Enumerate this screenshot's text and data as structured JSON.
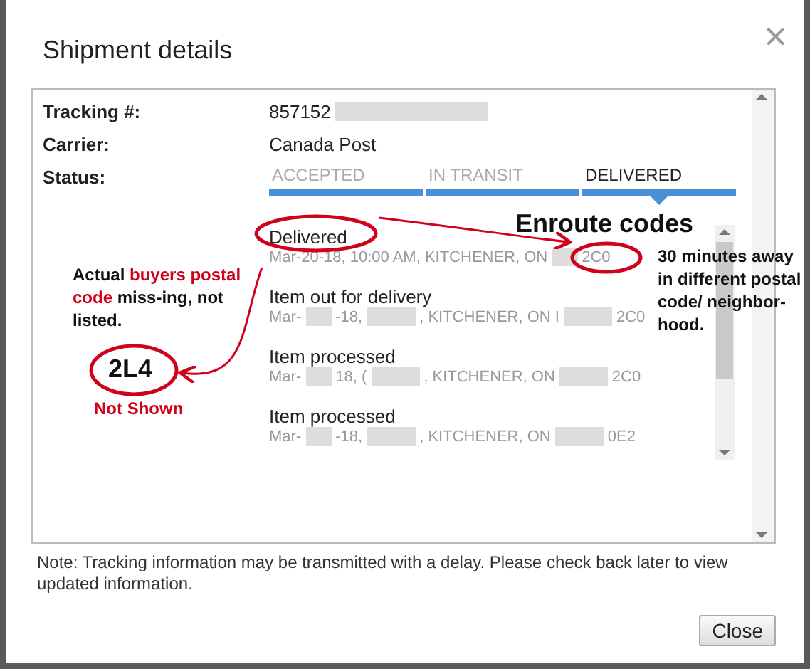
{
  "dialog": {
    "title": "Shipment details",
    "close_icon": "×"
  },
  "fields": [
    {
      "label": "Tracking #:",
      "value": "857152",
      "redacted": true
    },
    {
      "label": "Carrier:",
      "value": "Canada Post",
      "redacted": false
    },
    {
      "label": "Status:"
    }
  ],
  "status_steps": [
    {
      "label": "ACCEPTED",
      "selected": false
    },
    {
      "label": "IN TRANSIT",
      "selected": false
    },
    {
      "label": "DELIVERED",
      "selected": true
    }
  ],
  "events": [
    {
      "title": "Delivered",
      "detail": [
        {
          "kind": "text",
          "text": "Mar-20-18, 10:00 AM, KITCHENER, ON"
        },
        {
          "kind": "redacted"
        },
        {
          "kind": "text",
          "text": "2C0"
        }
      ]
    },
    {
      "title": "Item out for delivery",
      "detail": [
        {
          "kind": "text",
          "text": "Mar-"
        },
        {
          "kind": "redacted"
        },
        {
          "kind": "text",
          "text": "-18,"
        },
        {
          "kind": "redacted"
        },
        {
          "kind": "text",
          "text": ", KITCHENER, ON I"
        },
        {
          "kind": "redacted"
        },
        {
          "kind": "text",
          "text": "2C0"
        }
      ]
    },
    {
      "title": "Item processed",
      "detail": [
        {
          "kind": "text",
          "text": "Mar-"
        },
        {
          "kind": "redacted"
        },
        {
          "kind": "text",
          "text": "18, ("
        },
        {
          "kind": "redacted"
        },
        {
          "kind": "text",
          "text": ", KITCHENER, ON"
        },
        {
          "kind": "redacted"
        },
        {
          "kind": "text",
          "text": "2C0"
        }
      ]
    },
    {
      "title": "Item processed",
      "detail": [
        {
          "kind": "text",
          "text": "Mar-"
        },
        {
          "kind": "redacted"
        },
        {
          "kind": "text",
          "text": "-18,"
        },
        {
          "kind": "redacted"
        },
        {
          "kind": "text",
          "text": ", KITCHENER, ON"
        },
        {
          "kind": "redacted"
        },
        {
          "kind": "text",
          "text": "0E2"
        }
      ]
    }
  ],
  "note": "Note: Tracking information may be transmitted with a delay. Please check back later to view updated information.",
  "buttons": [
    "Close"
  ],
  "annotations": {
    "heading": "Enroute codes",
    "side_note": "30 minutes away in different postal code/ neighbor-hood.",
    "buyer_note": [
      {
        "text": "Actual ",
        "highlight": false
      },
      {
        "text": "buyers postal code",
        "highlight": true
      },
      {
        "text": " miss-ing, not listed.",
        "highlight": false
      }
    ],
    "code": "2L4",
    "code_caption": "Not Shown"
  }
}
